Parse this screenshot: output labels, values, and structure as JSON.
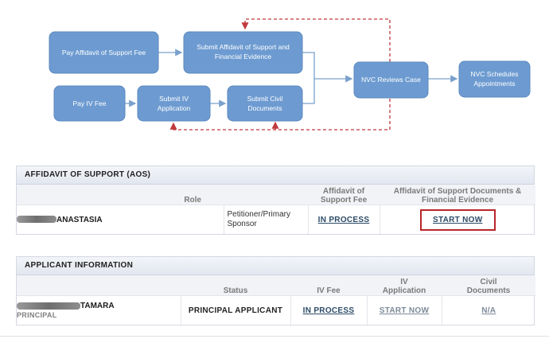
{
  "flowchart": {
    "nodes": {
      "pay_aos_fee": "Pay Affidavit of Support Fee",
      "submit_aos_line1": "Submit Affidavit of Support and",
      "submit_aos_line2": "Financial Evidence",
      "pay_iv_fee": "Pay IV Fee",
      "submit_iv_line1": "Submit IV",
      "submit_iv_line2": "Application",
      "submit_civil_line1": "Submit Civil",
      "submit_civil_line2": "Documents",
      "nvc_reviews": "NVC Reviews Case",
      "nvc_schedules_line1": "NVC Schedules",
      "nvc_schedules_line2": "Appointments"
    },
    "colors": {
      "node_fill": "#6d9bd1",
      "node_border": "#5a88be",
      "arrow": "#7aa0cc",
      "feedback_arrow": "#c0393c"
    }
  },
  "aos_panel": {
    "title": "AFFIDAVIT OF SUPPORT (AOS)",
    "columns": {
      "role": "Role",
      "fee_line1": "Affidavit of",
      "fee_line2": "Support Fee",
      "docs_line1": "Affidavit of Support Documents &",
      "docs_line2": "Financial Evidence"
    },
    "row": {
      "name": "ANASTASIA",
      "role_line1": "Petitioner/Primary",
      "role_line2": "Sponsor",
      "fee_status": "IN PROCESS",
      "docs_action": "START NOW"
    },
    "highlight_color": "#b8262b"
  },
  "applicant_panel": {
    "title": "APPLICANT INFORMATION",
    "columns": {
      "status": "Status",
      "iv_fee": "IV Fee",
      "iv_app_line1": "IV",
      "iv_app_line2": "Application",
      "civil_line1": "Civil",
      "civil_line2": "Documents"
    },
    "row": {
      "name": "TAMARA",
      "subtitle": "PRINCIPAL",
      "status": "PRINCIPAL APPLICANT",
      "iv_fee_status": "IN PROCESS",
      "iv_app_action": "START NOW",
      "civil_docs_status": "N/A"
    }
  }
}
